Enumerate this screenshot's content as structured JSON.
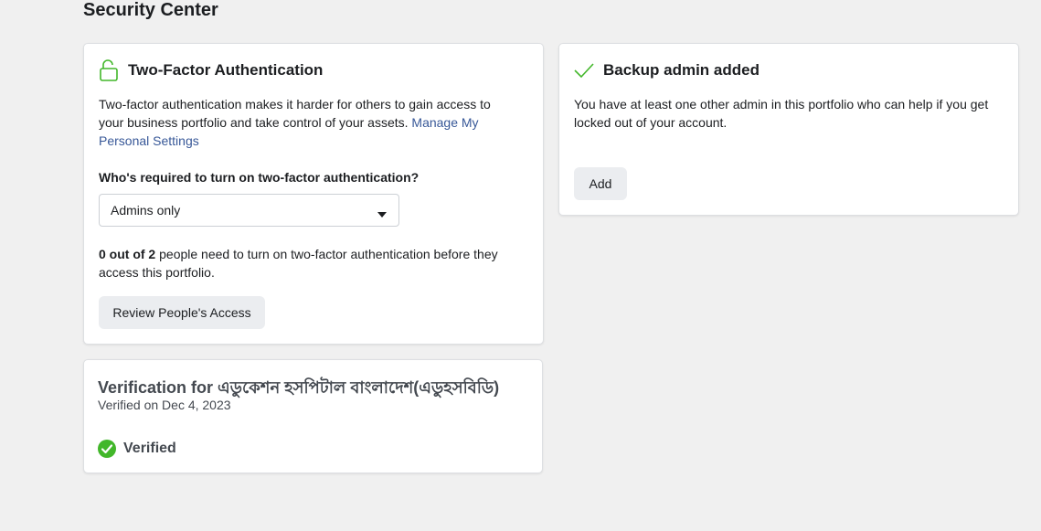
{
  "page": {
    "title": "Security Center"
  },
  "two_factor": {
    "icon": "unlock-icon",
    "heading": "Two-Factor Authentication",
    "description": "Two-factor authentication makes it harder for others to gain access to your business portfolio and take control of your assets.",
    "link_label": "Manage My Personal Settings",
    "question": "Who's required to turn on two-factor authentication?",
    "select_value": "Admins only",
    "status_count": "0 out of 2",
    "status_rest": "people need to turn on two-factor authentication before they access this portfolio.",
    "review_button": "Review People's Access"
  },
  "backup_admin": {
    "icon": "checkmark-icon",
    "heading": "Backup admin added",
    "description": "You have at least one other admin in this portfolio who can help if you get locked out of your account.",
    "add_button": "Add"
  },
  "verification": {
    "title": "Verification for এডুকেশন হসপিটাল বাংলাদেশ(এডুহসবিডি)",
    "date": "Verified on Dec 4, 2023",
    "status_icon": "check-circle-icon",
    "status_label": "Verified"
  },
  "colors": {
    "background": "#f0f0f0",
    "card": "#ffffff",
    "success_green": "#42b72a",
    "link_blue": "#385898",
    "button_gray": "#ebedf0"
  }
}
